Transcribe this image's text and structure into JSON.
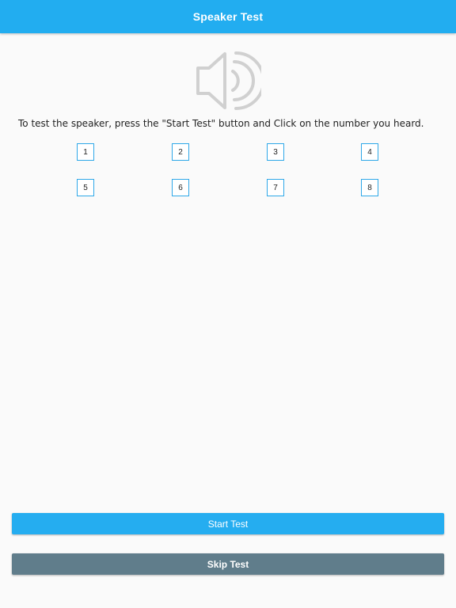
{
  "header": {
    "title": "Speaker Test"
  },
  "icons": {
    "speaker": "speaker-icon"
  },
  "instruction": "To test the speaker, press the \"Start Test\" button and Click on the number you heard.",
  "numbers": [
    "1",
    "2",
    "3",
    "4",
    "5",
    "6",
    "7",
    "8"
  ],
  "buttons": {
    "start": "Start Test",
    "skip": "Skip Test"
  },
  "colors": {
    "app_bar": "#22adf0",
    "start_button": "#25adf0",
    "skip_button": "#607d8b",
    "number_border": "#2ea8e8",
    "icon": "#d0d0d0"
  }
}
